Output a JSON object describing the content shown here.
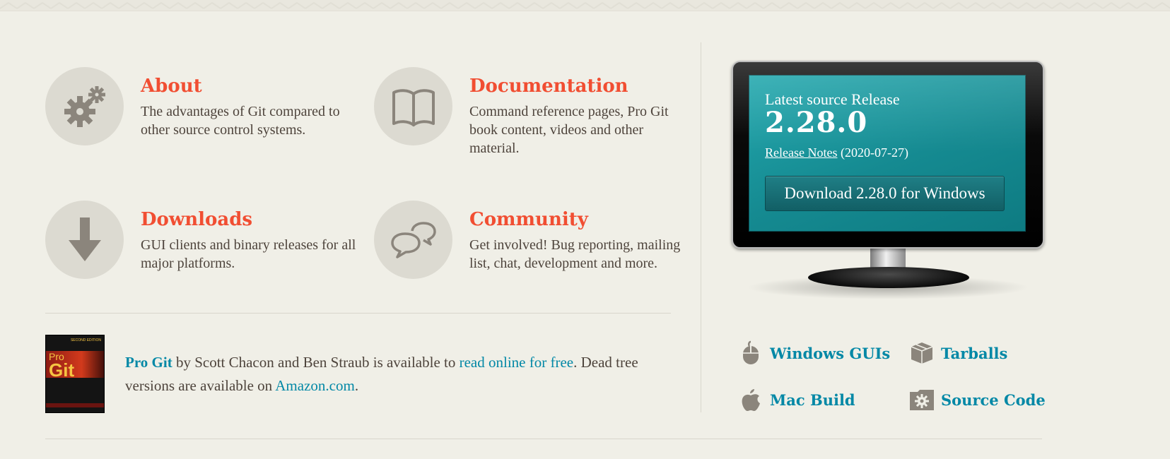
{
  "features": [
    {
      "title": "About",
      "desc": "The advantages of Git compared to other source control systems.",
      "icon": "gears-icon"
    },
    {
      "title": "Documentation",
      "desc": "Command reference pages, Pro Git book content, videos and other material.",
      "icon": "book-icon"
    },
    {
      "title": "Downloads",
      "desc": "GUI clients and binary releases for all major platforms.",
      "icon": "download-arrow-icon"
    },
    {
      "title": "Community",
      "desc": "Get involved! Bug reporting, mailing list, chat, development and more.",
      "icon": "chat-bubbles-icon"
    }
  ],
  "progit": {
    "book_title": "Pro Git",
    "text1": " by Scott Chacon and Ben Straub is available to ",
    "read_link": "read online for free",
    "text2": ". Dead tree versions are available on ",
    "amazon_link": "Amazon.com",
    "text3": ".",
    "cover": {
      "pro": "Pro",
      "git": "Git",
      "series": "SECOND EDITION"
    }
  },
  "release": {
    "label": "Latest source Release",
    "version": "2.28.0",
    "notes_link": "Release Notes",
    "date": "(2020-07-27)",
    "download_button": "Download 2.28.0 for Windows"
  },
  "platforms": [
    {
      "label": "Windows GUIs",
      "icon": "mouse-icon"
    },
    {
      "label": "Tarballs",
      "icon": "box-icon"
    },
    {
      "label": "Mac Build",
      "icon": "apple-icon"
    },
    {
      "label": "Source Code",
      "icon": "gear-folder-icon"
    }
  ],
  "colors": {
    "background": "#f0efe7",
    "accent_red": "#f14e32",
    "link_blue": "#0388a6",
    "text": "#4e443c",
    "icon_circle": "#dcdad1",
    "icon_fill": "#8b857c",
    "screen_teal": "#158a91"
  }
}
